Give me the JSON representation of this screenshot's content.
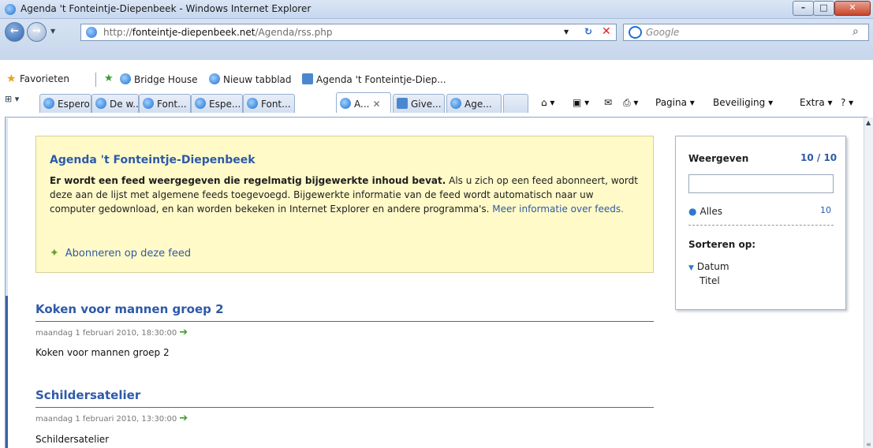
{
  "window": {
    "title": "Agenda 't Fonteintje-Diepenbeek - Windows Internet Explorer",
    "min_glyph": "–",
    "max_glyph": "□",
    "close_glyph": "✕"
  },
  "address": {
    "url_prefix": "http://",
    "url_host": "fonteintje-diepenbeek.net",
    "url_path": "/Agenda/rss.php",
    "search_placeholder": "Google"
  },
  "favorites": {
    "label": "Favorieten",
    "links": [
      "Bridge House",
      "Nieuw tabblad",
      "Agenda 't Fonteintje-Diep..."
    ]
  },
  "tabs": [
    "Espero",
    "De w...",
    "Font...",
    "Espe...",
    "Font...",
    "A...",
    "Give...",
    "Age..."
  ],
  "toolbar": {
    "page": "Pagina ▾",
    "security": "Beveiliging ▾",
    "extra": "Extra ▾"
  },
  "feed": {
    "title": "Agenda 't Fonteintje-Diepenbeek",
    "intro_bold": "Er wordt een feed weergegeven die regelmatig bijgewerkte inhoud bevat.",
    "intro_rest": " Als u zich op een feed abonneert, wordt deze aan de lijst met algemene feeds toegevoegd. Bijgewerkte informatie van de feed wordt automatisch naar uw computer gedownload, en kan worden bekeken in Internet Explorer en andere programma's. ",
    "more_link": "Meer informatie over feeds.",
    "subscribe_link": "Abonneren op deze feed"
  },
  "entries": [
    {
      "title": "Koken voor mannen groep 2",
      "date": "maandag 1 februari 2010, 18:30:00",
      "desc": "Koken voor mannen groep 2"
    },
    {
      "title": "Schildersatelier",
      "date": "maandag 1 februari 2010, 13:30:00",
      "desc": "Schildersatelier"
    }
  ],
  "side": {
    "display_label": "Weergeven",
    "display_count": "10 / 10",
    "all_label": "Alles",
    "all_count": "10",
    "sort_label": "Sorteren op:",
    "sort_date": "Datum",
    "sort_title": "Titel"
  },
  "colors": {
    "accent": "#2d5aa8",
    "info_bg": "#fffac8",
    "chrome": "#c6d6ec"
  }
}
